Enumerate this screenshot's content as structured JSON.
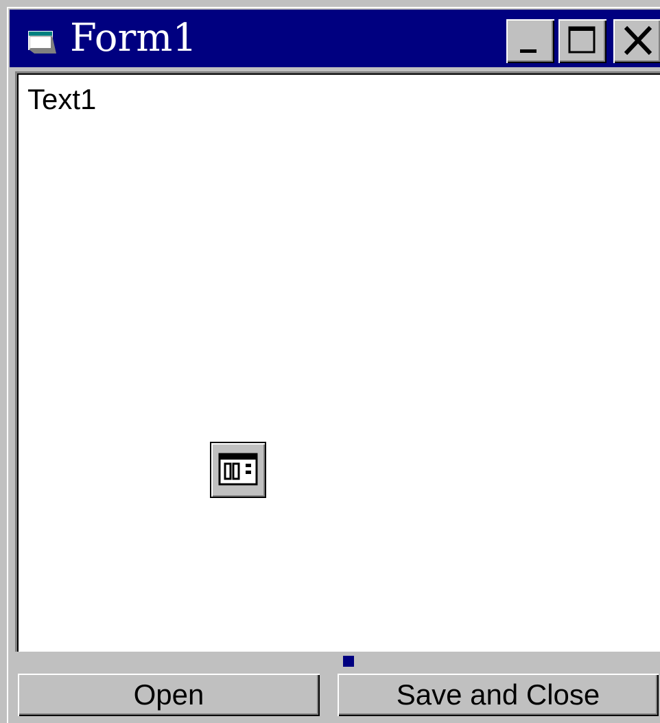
{
  "window": {
    "title": "Form1",
    "title_bar_color": "#000080",
    "icon": "form-window-icon",
    "caption_buttons": [
      {
        "name": "minimize",
        "glyph": "_"
      },
      {
        "name": "maximize",
        "glyph": "□"
      },
      {
        "name": "close",
        "glyph": "X"
      }
    ]
  },
  "textbox": {
    "value": "Text1"
  },
  "controls": {
    "dialog_control_icon": "common-dialog-icon",
    "selection_handle_color": "#000080"
  },
  "buttons": {
    "open_label": "Open",
    "save_close_label": "Save and Close"
  }
}
